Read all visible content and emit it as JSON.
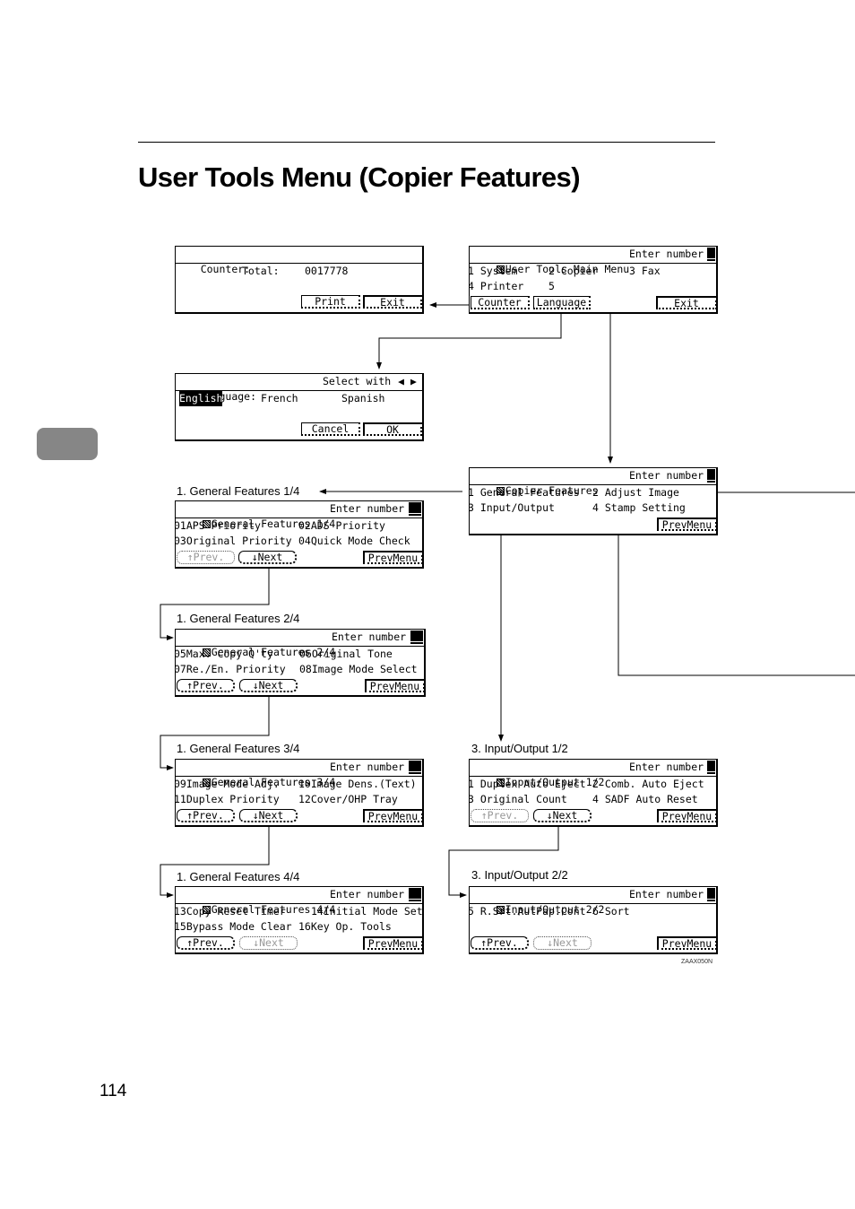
{
  "page": {
    "title": "User Tools Menu (Copier Features)",
    "page_number": "114",
    "figure_code": "ZAAX050N"
  },
  "icons": {
    "screen_icon": "grid-icon",
    "cursor": "block-cursor",
    "left_arrow": "◀",
    "right_arrow": "▶",
    "up_arrow": "↑",
    "down_arrow": "↓"
  },
  "counter_screen": {
    "title": "Counter:",
    "total_label": "Total:",
    "total_value": "0017778",
    "print_label": "Print",
    "exit_label": "Exit"
  },
  "main_menu": {
    "title": "User Tools Main Menu",
    "prompt": "Enter number",
    "items": [
      "1 System",
      "2 Copier",
      "3 Fax",
      "4 Printer",
      "5"
    ],
    "counter_label": "Counter",
    "language_label": "Language",
    "exit_label": "Exit"
  },
  "language_screen": {
    "title": "Language:",
    "select_hint": "Select with",
    "options": [
      "English",
      "French",
      "Spanish"
    ],
    "selected": "English",
    "cancel_label": "Cancel",
    "ok_label": "OK"
  },
  "copier_features": {
    "title": "Copier Features",
    "prompt": "Enter number",
    "items": [
      "1 General Features",
      "2 Adjust Image",
      "3 Input/Output",
      "4 Stamp Setting"
    ],
    "prevmenu_label": "PrevMenu"
  },
  "general_features": [
    {
      "caption": "1. General Features 1/4",
      "title": "General Features 1/4",
      "prompt": "Enter number",
      "rows": [
        [
          "01APS Priority",
          "02ADS Priority"
        ],
        [
          "03Original Priority",
          "04Quick Mode Check"
        ]
      ],
      "prev_label": "↑Prev.",
      "prev_enabled": false,
      "next_label": "↓Next",
      "next_enabled": true,
      "prevmenu_label": "PrevMenu"
    },
    {
      "caption": "1. General Features 2/4",
      "title": "General Features 2/4",
      "prompt": "Enter number",
      "rows": [
        [
          "05Max. Copy Q'ty",
          "06Original Tone"
        ],
        [
          "07Re./En. Priority",
          "08Image Mode Select"
        ]
      ],
      "prev_label": "↑Prev.",
      "prev_enabled": true,
      "next_label": "↓Next",
      "next_enabled": true,
      "prevmenu_label": "PrevMenu"
    },
    {
      "caption": "1. General Features 3/4",
      "title": "General Features 3/4",
      "prompt": "Enter number",
      "rows": [
        [
          "09Image Mode Adj.",
          "10Image Dens.(Text)"
        ],
        [
          "11Duplex Priority",
          "12Cover/OHP Tray"
        ]
      ],
      "prev_label": "↑Prev.",
      "prev_enabled": true,
      "next_label": "↓Next",
      "next_enabled": true,
      "prevmenu_label": "PrevMenu"
    },
    {
      "caption": "1. General Features 4/4",
      "title": "General Features 4/4",
      "prompt": "Enter number",
      "rows": [
        [
          "13Copy Reset Timer",
          "14Initial Mode Set"
        ],
        [
          "15Bypass Mode Clear",
          "16Key Op. Tools"
        ]
      ],
      "prev_label": "↑Prev.",
      "prev_enabled": true,
      "next_label": "↓Next",
      "next_enabled": false,
      "prevmenu_label": "PrevMenu"
    }
  ],
  "input_output": [
    {
      "caption": "3. Input/Output 1/2",
      "title": "Input/Output 1/2",
      "prompt": "Enter number",
      "rows": [
        [
          "1 Duplex Auto Eject",
          "2 Comb. Auto Eject"
        ],
        [
          "3 Original Count",
          "4 SADF Auto Reset"
        ]
      ],
      "prev_label": "↑Prev.",
      "prev_enabled": false,
      "next_label": "↓Next",
      "next_enabled": true,
      "prevmenu_label": "PrevMenu"
    },
    {
      "caption": "3. Input/Output 2/2",
      "title": "Input/Output 2/2",
      "prompt": "Enter number",
      "rows": [
        [
          "5 R.Srt.AutPap.Cont",
          "6 Sort"
        ]
      ],
      "prev_label": "↑Prev.",
      "prev_enabled": true,
      "next_label": "↓Next",
      "next_enabled": false,
      "prevmenu_label": "PrevMenu"
    }
  ]
}
